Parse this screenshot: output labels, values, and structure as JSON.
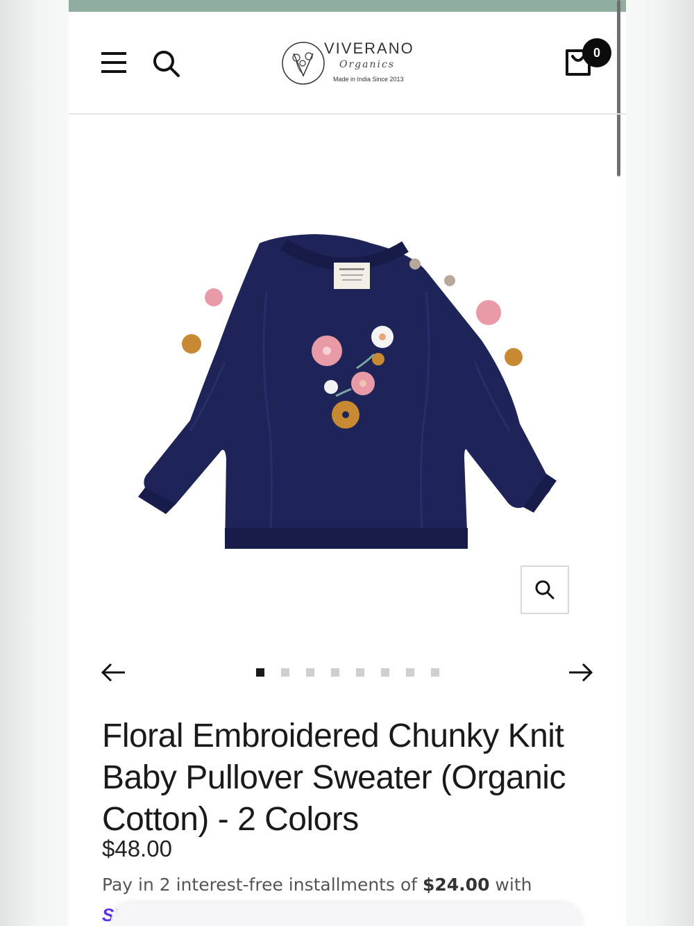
{
  "colors": {
    "top_band": "#8fae9f",
    "sweater": "#1e2458",
    "text": "#1a1a1a",
    "badge_bg": "#0c0c0c",
    "shop_pay": "#5a31f4"
  },
  "header": {
    "menu_icon": "hamburger-menu-icon",
    "search_icon": "search-icon",
    "logo": {
      "brand": "VIVERANO",
      "sub": "Organics",
      "tagline": "Made in India Since 2013"
    },
    "cart": {
      "icon": "shopping-bag-icon",
      "count": "0"
    }
  },
  "gallery": {
    "image_alt_icon": "sweater-image",
    "zoom_icon": "zoom-search-icon",
    "prev_icon": "arrow-left-icon",
    "next_icon": "arrow-right-icon",
    "slide_count": 8,
    "active_slide": 1
  },
  "product": {
    "title": "Floral Embroidered Chunky Knit Baby Pullover Sweater (Organic Cotton) - 2 Colors",
    "price": "$48.00",
    "installments_prefix": "Pay in 2 interest-free installments of ",
    "installments_amount": "$24.00",
    "installments_suffix": " with",
    "shop_pay_logo": "S'"
  }
}
